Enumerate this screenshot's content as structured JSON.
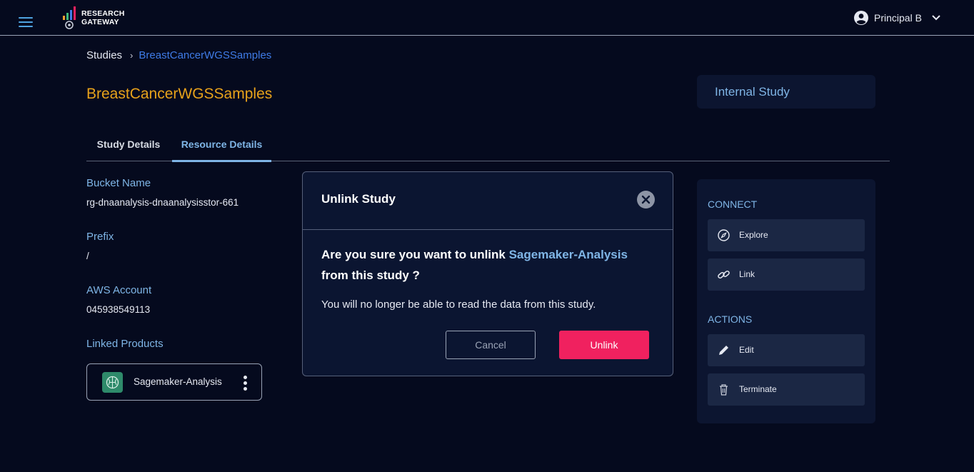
{
  "header": {
    "menu_icon": "hamburger-menu-icon",
    "logo_line1": "RESEARCH",
    "logo_line2": "GATEWAY",
    "user_name": "Principal B",
    "user_icon": "account-circle-icon",
    "dropdown_icon": "chevron-down-icon"
  },
  "breadcrumb": {
    "root": "Studies",
    "separator": "›",
    "current": "BreastCancerWGSSamples"
  },
  "page": {
    "title": "BreastCancerWGSSamples",
    "study_type": "Internal Study"
  },
  "tabs": [
    {
      "label": "Study Details",
      "active": false
    },
    {
      "label": "Resource Details",
      "active": true
    }
  ],
  "details": {
    "bucket_label": "Bucket Name",
    "bucket_value": "rg-dnaanalysis-dnaanalysisstor-661",
    "prefix_label": "Prefix",
    "prefix_value": "/",
    "aws_label": "AWS Account",
    "aws_value": "045938549113",
    "linked_label": "Linked Products",
    "linked_products": [
      {
        "name": "Sagemaker-Analysis",
        "icon": "sagemaker-brain-icon"
      }
    ]
  },
  "side_panel": {
    "connect_heading": "CONNECT",
    "connect_items": [
      {
        "label": "Explore",
        "icon": "compass-icon"
      },
      {
        "label": "Link",
        "icon": "link-icon"
      }
    ],
    "actions_heading": "ACTIONS",
    "action_items": [
      {
        "label": "Edit",
        "icon": "pencil-icon"
      },
      {
        "label": "Terminate",
        "icon": "trash-icon"
      }
    ]
  },
  "modal": {
    "title": "Unlink Study",
    "question_prefix": "Are you sure you want to unlink ",
    "question_product": "Sagemaker-Analysis",
    "question_suffix": "from this study ?",
    "note": "You will no longer be able to read the data from this study.",
    "cancel_label": "Cancel",
    "confirm_label": "Unlink"
  },
  "colors": {
    "background": "#050a1e",
    "accent_blue": "#7fb5e6",
    "title_orange": "#e8a21b",
    "danger": "#f0215f",
    "link_blue": "#3f7be6"
  }
}
